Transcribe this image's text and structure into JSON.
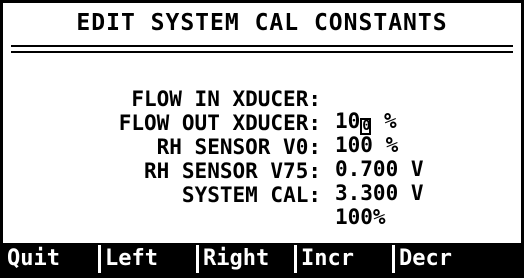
{
  "title": "EDIT SYSTEM CAL CONSTANTS",
  "fields": [
    {
      "label": "FLOW IN XDUCER:",
      "value_prefix": "10",
      "value_cursor": "0",
      "value_suffix": " %"
    },
    {
      "label": "FLOW OUT XDUCER:",
      "value": "100 %"
    },
    {
      "label": "RH SENSOR V0:",
      "value": "0.700 V"
    },
    {
      "label": "RH SENSOR V75:",
      "value": "3.300 V"
    },
    {
      "label": "SYSTEM CAL:",
      "value": "100%"
    }
  ],
  "menu": [
    "Quit",
    "Left",
    "Right",
    "Incr",
    "Decr"
  ]
}
